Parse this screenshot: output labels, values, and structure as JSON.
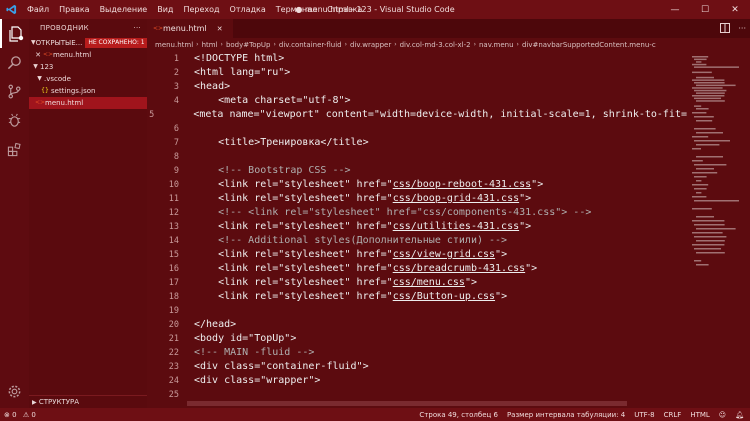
{
  "titlebar": {
    "menu": [
      "Файл",
      "Правка",
      "Выделение",
      "Вид",
      "Переход",
      "Отладка",
      "Терминал",
      "Справка"
    ],
    "window_title": "● menu.html - 123 - Visual Studio Code",
    "minimize": "—",
    "maximize": "☐",
    "close": "✕"
  },
  "sidebar": {
    "header": "ПРОВОДНИК",
    "header_more": "···",
    "open_editors_label": "ОТКРЫТЫЕ...",
    "unsaved_badge": "НЕ СОХРАНЕНО: 1",
    "open_file": "menu.html",
    "folder": "123",
    "subfolder": ".vscode",
    "settings_file": "settings.json",
    "active_file": "menu.html",
    "outline_label": "СТРУКТУРА"
  },
  "editor": {
    "tab_label": "menu.html",
    "breadcrumb": [
      "menu.html",
      "html",
      "body#TopUp",
      "div.container-fluid",
      "div.wrapper",
      "div.col-md-3.col-xl-2",
      "nav.menu",
      "div#navbarSupportedContent.menu-c"
    ],
    "lines": [
      {
        "n": "1",
        "text": "<!DOCTYPE html>",
        "cls": ""
      },
      {
        "n": "2",
        "text": "<html lang=\"ru\">",
        "cls": ""
      },
      {
        "n": "3",
        "text": "<head>",
        "cls": ""
      },
      {
        "n": "4",
        "text": "    <meta charset=\"utf-8\">",
        "cls": ""
      },
      {
        "n": "5",
        "text": "    <meta name=\"viewport\" content=\"width=device-width, initial-scale=1, shrink-to-fit=",
        "cls": ""
      },
      {
        "n": "6",
        "text": "",
        "cls": ""
      },
      {
        "n": "7",
        "text": "    <title>Тренировка</title>",
        "cls": ""
      },
      {
        "n": "8",
        "text": "",
        "cls": ""
      },
      {
        "n": "9",
        "text": "    <!-- Bootstrap CSS -->",
        "cls": "t-comment"
      },
      {
        "n": "10",
        "pre": "    <link rel=\"stylesheet\" href=\"",
        "link": "css/boop-reboot-431.css",
        "post": "\">"
      },
      {
        "n": "11",
        "pre": "    <link rel=\"stylesheet\" href=\"",
        "link": "css/boop-grid-431.css",
        "post": "\">"
      },
      {
        "n": "12",
        "text": "    <!-- <link rel=\"stylesheet\" href=\"css/components-431.css\"> -->",
        "cls": "t-comment"
      },
      {
        "n": "13",
        "pre": "    <link rel=\"stylesheet\" href=\"",
        "link": "css/utilities-431.css",
        "post": "\">"
      },
      {
        "n": "14",
        "text": "    <!-- Additional styles(Дополнительные стили) -->",
        "cls": "t-comment"
      },
      {
        "n": "15",
        "pre": "    <link rel=\"stylesheet\" href=\"",
        "link": "css/view-grid.css",
        "post": "\">"
      },
      {
        "n": "16",
        "pre": "    <link rel=\"stylesheet\" href=\"",
        "link": "css/breadcrumb-431.css",
        "post": "\">"
      },
      {
        "n": "17",
        "pre": "    <link rel=\"stylesheet\" href=\"",
        "link": "css/menu.css",
        "post": "\">"
      },
      {
        "n": "18",
        "pre": "    <link rel=\"stylesheet\" href=\"",
        "link": "css/Button-up.css",
        "post": "\">"
      },
      {
        "n": "19",
        "text": "",
        "cls": ""
      },
      {
        "n": "20",
        "text": "</head>",
        "cls": ""
      },
      {
        "n": "21",
        "text": "<body id=\"TopUp\">",
        "cls": ""
      },
      {
        "n": "22",
        "text": "<!-- MAIN -fluid -->",
        "cls": "t-comment"
      },
      {
        "n": "23",
        "text": "<div class=\"container-fluid\">",
        "cls": ""
      },
      {
        "n": "24",
        "text": "<div class=\"wrapper\">",
        "cls": ""
      },
      {
        "n": "25",
        "text": "",
        "cls": ""
      }
    ]
  },
  "statusbar": {
    "errors": "0",
    "warnings": "0",
    "cursor": "Строка 49, столбец 6",
    "indent": "Размер интервала табуляции: 4",
    "encoding": "UTF-8",
    "eol": "CRLF",
    "language": "HTML"
  },
  "colors": {
    "background": "#5c0b0f",
    "titlebar": "#6e0f14",
    "selection": "#a0141c",
    "badge": "#b71c1c"
  }
}
